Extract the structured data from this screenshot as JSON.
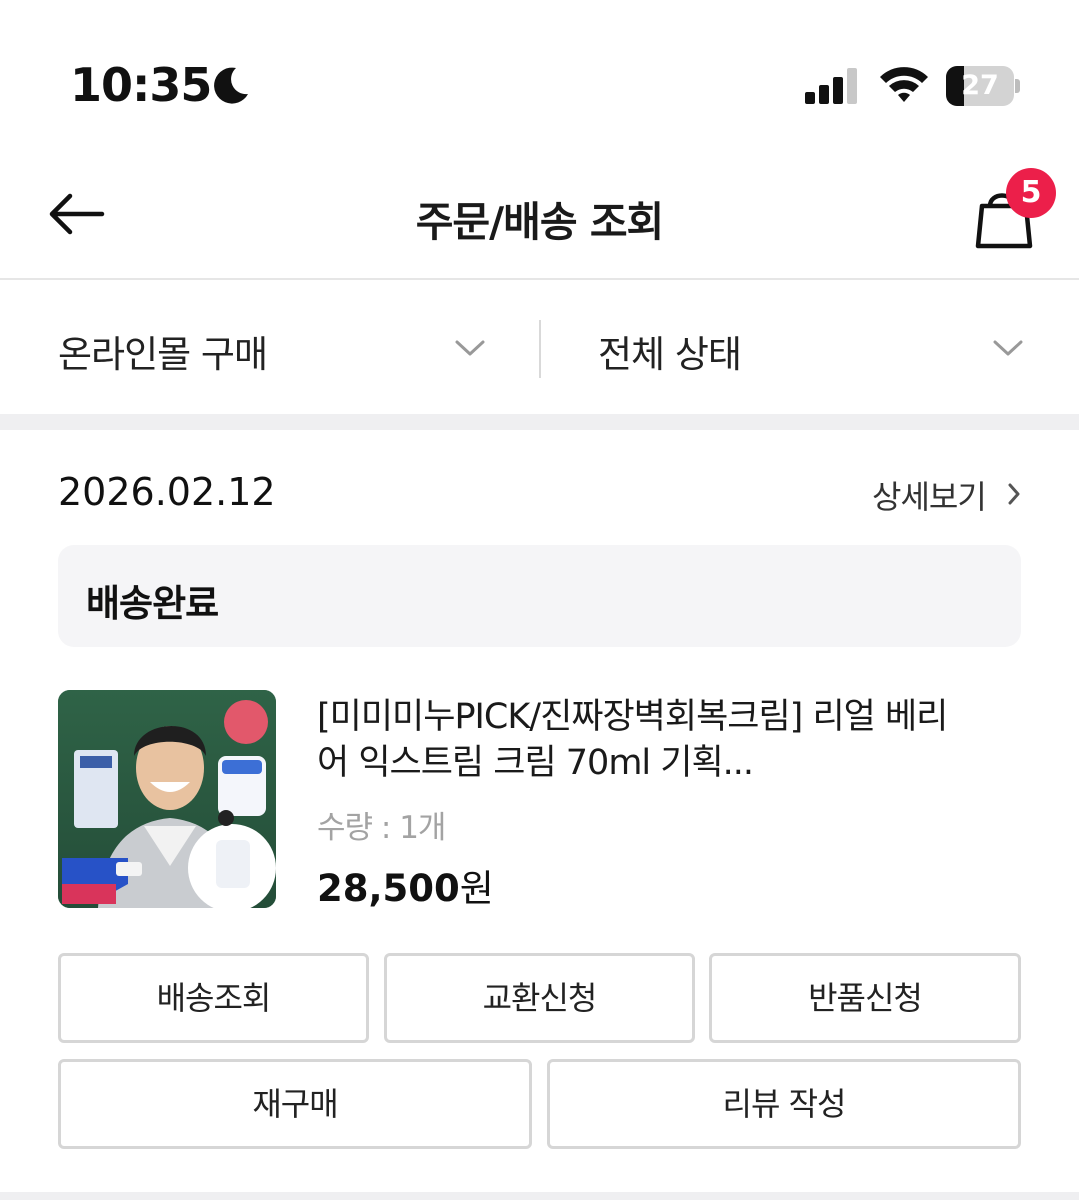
{
  "status_bar": {
    "time": "10:35",
    "battery": "27",
    "battery_level": 0.27,
    "icons": [
      "moon-icon",
      "signal-icon",
      "wifi-icon",
      "battery-icon"
    ]
  },
  "header": {
    "title": "주문/배송 조회",
    "cart_count": "5",
    "icons": [
      "back-arrow-icon",
      "shopping-bag-icon"
    ]
  },
  "filters": {
    "purchase_type": "온라인몰 구매",
    "status": "전체 상태"
  },
  "order": {
    "date": "2026.02.12",
    "detail_link": "상세보기",
    "status": "배송완료",
    "product": {
      "name": "[미미미누PICK/진짜장벽회복크림] 리얼 베리어 익스트림 크림 70ml 기획...",
      "quantity": "수량 : 1개",
      "price": "28,500",
      "currency": "원"
    },
    "buttons": {
      "track": "배송조회",
      "exchange": "교환신청",
      "return": "반품신청",
      "repurchase": "재구매",
      "review": "리뷰 작성"
    }
  },
  "colors": {
    "badge": "#ec1f4a",
    "divider_band": "#efeff1",
    "status_box": "#f5f5f7",
    "button_border": "#d6d6d6"
  }
}
